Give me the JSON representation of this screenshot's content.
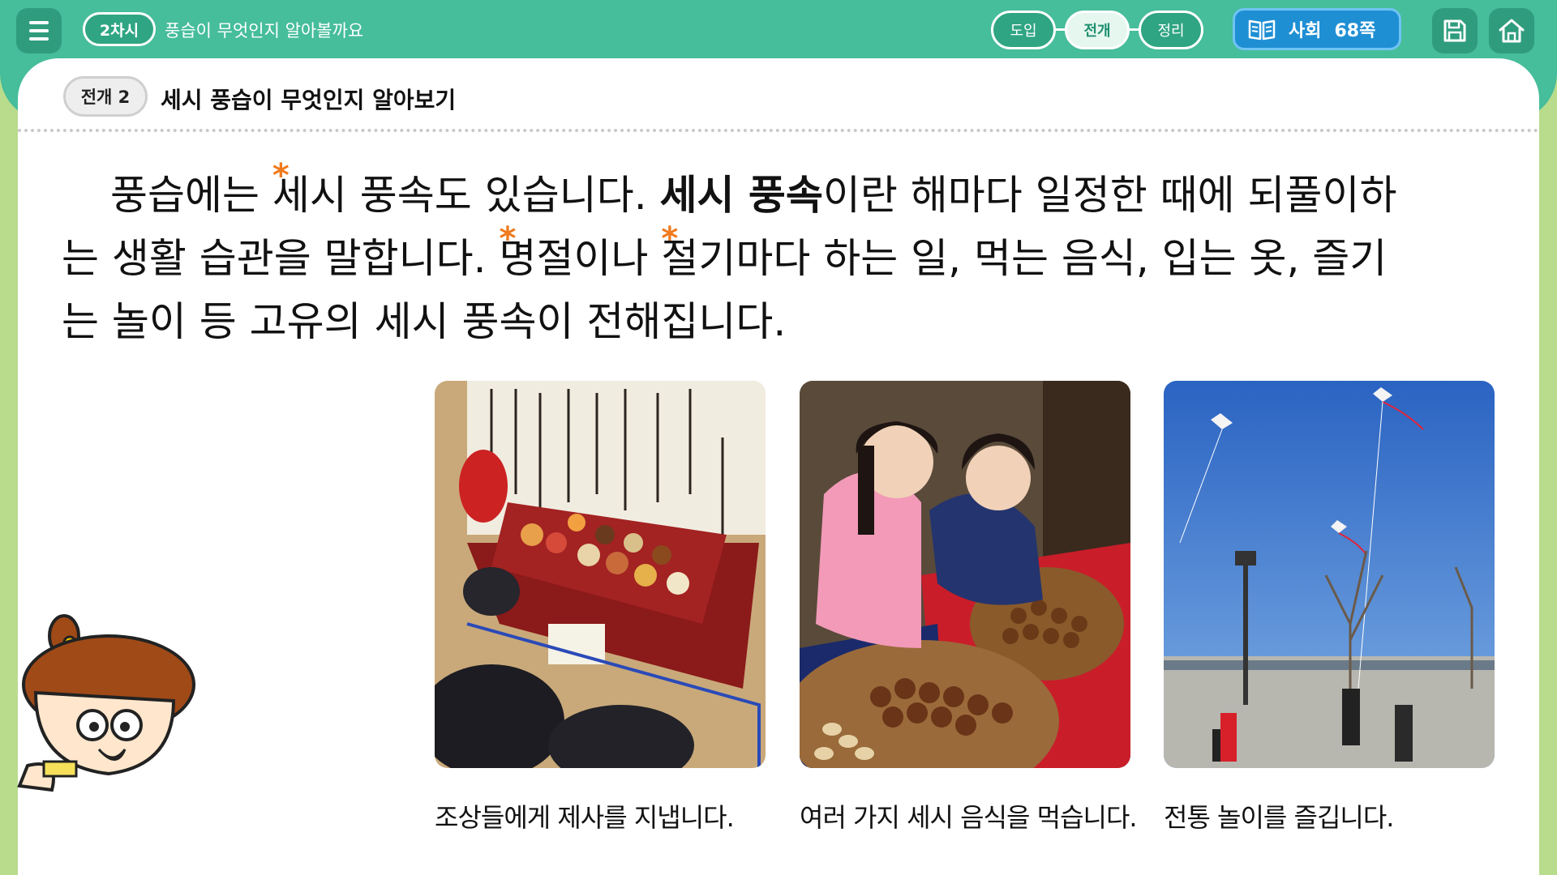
{
  "header": {
    "lesson_badge": "2차시",
    "lesson_title": "풍습이 무엇인지 알아볼까요",
    "steps": [
      {
        "label": "도입",
        "active": false
      },
      {
        "label": "전개",
        "active": true
      },
      {
        "label": "정리",
        "active": false
      }
    ],
    "textbook": {
      "subject": "사회",
      "page": "68쪽"
    },
    "icons": {
      "menu": "hamburger-icon",
      "book": "open-book-icon",
      "save": "save-icon",
      "home": "home-icon"
    }
  },
  "section": {
    "badge": "전개 2",
    "title": "세시 풍습이 무엇인지 알아보기"
  },
  "paragraph": {
    "line1_a": "풍습에는 ",
    "line1_star": "세",
    "line1_b": "시 풍속도 있습니다. ",
    "line1_bold": "세시 풍속",
    "line1_c": "이란 해마다 일정한 때에 되풀이하",
    "line2_a": "는 생활 습관을 말합니다. ",
    "line2_star1": "명",
    "line2_b": "절이나 ",
    "line2_star2": "절",
    "line2_c": "기마다 하는 일, 먹는 음식, 입는 옷, 즐기",
    "line3": "는 놀이 등 고유의 세시 풍속이 전해집니다."
  },
  "photos": [
    {
      "caption": "조상들에게 제사를 지냅니다."
    },
    {
      "caption": "여러 가지 세시 음식을 먹습니다."
    },
    {
      "caption": "전통 놀이를 즐깁니다."
    }
  ],
  "colors": {
    "brand_green": "#46bd9b",
    "accent_orange": "#f07a1d",
    "textbook_blue": "#1f8fd4"
  }
}
